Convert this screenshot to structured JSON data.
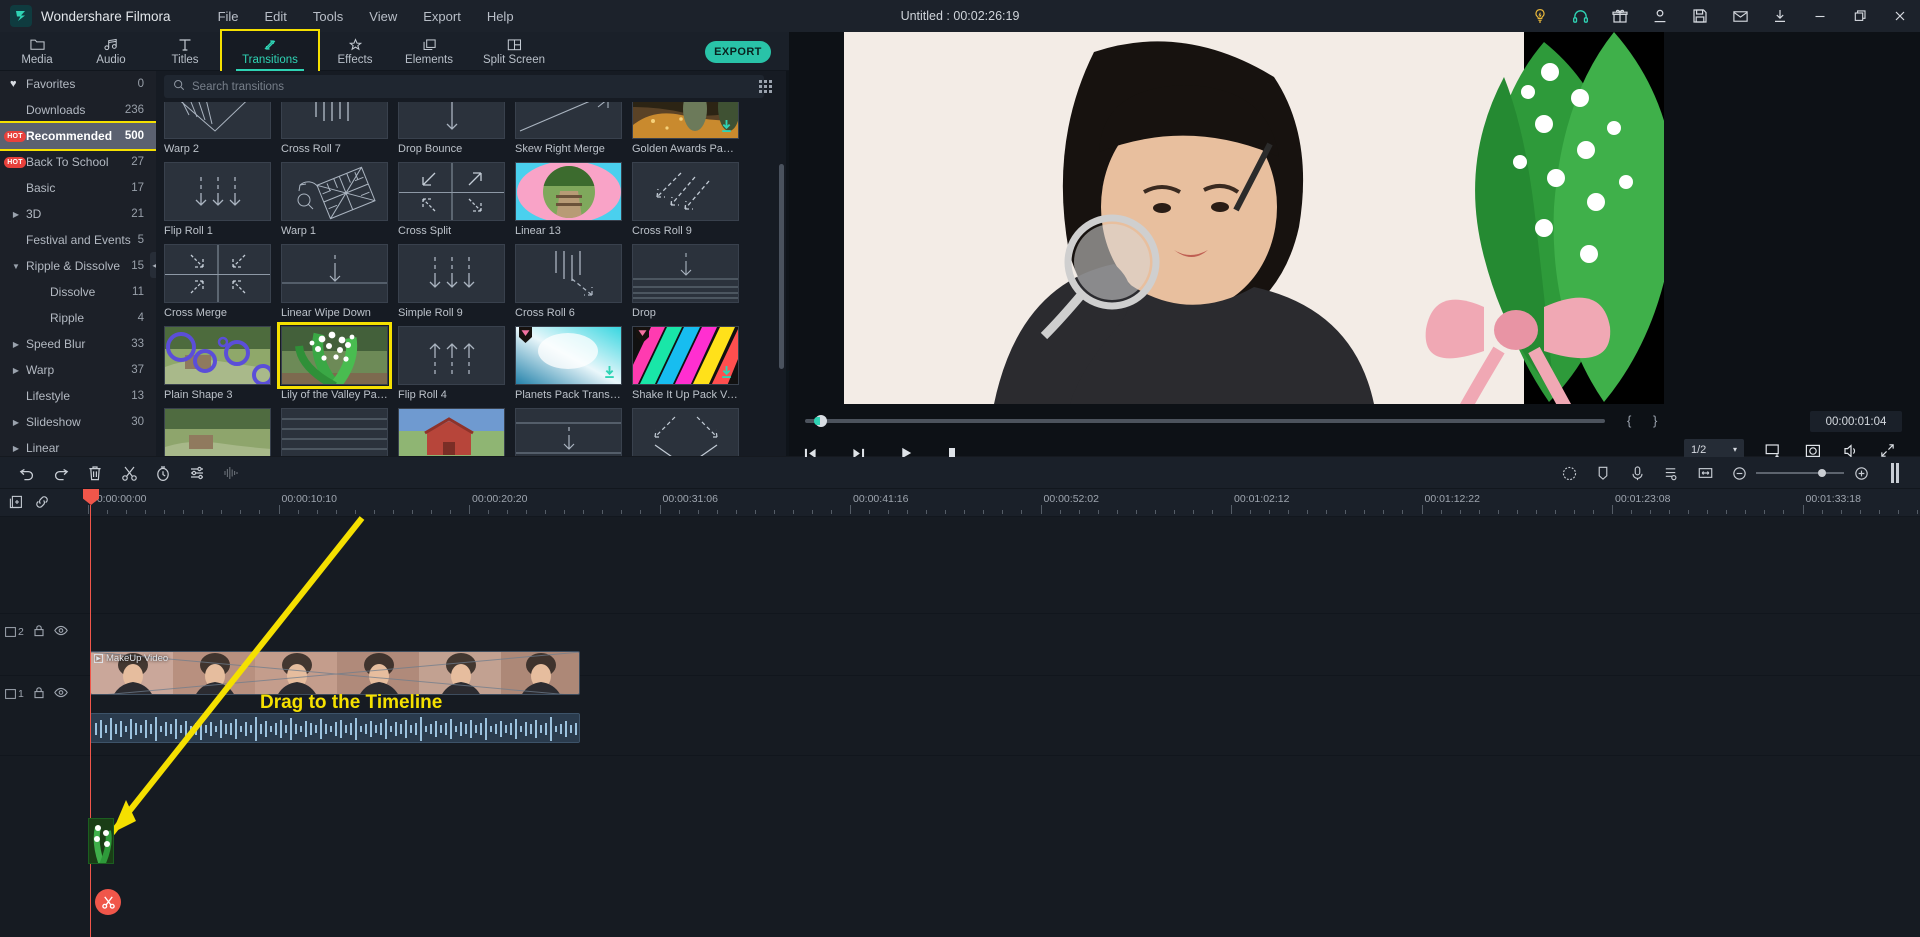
{
  "titlebar": {
    "app_name": "Wondershare Filmora",
    "document_title": "Untitled : 00:02:26:19",
    "menus": [
      "File",
      "Edit",
      "Tools",
      "View",
      "Export",
      "Help"
    ],
    "right_icons": [
      "lightbulb-icon",
      "headset-icon",
      "gift-icon",
      "account-icon",
      "save-icon",
      "mail-icon",
      "download-icon"
    ],
    "window_buttons": [
      "minimize-icon",
      "maximize-icon",
      "close-icon"
    ],
    "accent": "#2fd3b4"
  },
  "tabbar": {
    "tabs": [
      {
        "label": "Media",
        "icon": "folder-icon"
      },
      {
        "label": "Audio",
        "icon": "music-note-icon"
      },
      {
        "label": "Titles",
        "icon": "text-t-icon"
      },
      {
        "label": "Transitions",
        "icon": "transition-arrows-icon"
      },
      {
        "label": "Effects",
        "icon": "sparkle-icon"
      },
      {
        "label": "Elements",
        "icon": "layers-icon"
      },
      {
        "label": "Split Screen",
        "icon": "split-screen-icon"
      }
    ],
    "active_tab": "Transitions",
    "export_label": "EXPORT",
    "highlight_color": "#f5e000"
  },
  "sidebar": {
    "items": [
      {
        "label": "Favorites",
        "count": "0",
        "level": 0,
        "icon": "heart-icon",
        "badge": "",
        "arrow": ""
      },
      {
        "label": "Downloads",
        "count": "236",
        "level": 0,
        "icon": "",
        "badge": "",
        "arrow": ""
      },
      {
        "label": "Recommended",
        "count": "500",
        "level": 0,
        "icon": "",
        "badge": "HOT",
        "arrow": "",
        "selected": true
      },
      {
        "label": "Back To School",
        "count": "27",
        "level": 0,
        "icon": "",
        "badge": "HOT",
        "arrow": ""
      },
      {
        "label": "Basic",
        "count": "17",
        "level": 0,
        "icon": "",
        "badge": "",
        "arrow": ""
      },
      {
        "label": "3D",
        "count": "21",
        "level": 0,
        "icon": "",
        "badge": "",
        "arrow": "collapsed"
      },
      {
        "label": "Festival and Events",
        "count": "5",
        "level": 0,
        "icon": "",
        "badge": "",
        "arrow": ""
      },
      {
        "label": "Ripple & Dissolve",
        "count": "15",
        "level": 0,
        "icon": "",
        "badge": "",
        "arrow": "expanded"
      },
      {
        "label": "Dissolve",
        "count": "11",
        "level": 1,
        "icon": "",
        "badge": "",
        "arrow": ""
      },
      {
        "label": "Ripple",
        "count": "4",
        "level": 1,
        "icon": "",
        "badge": "",
        "arrow": ""
      },
      {
        "label": "Speed Blur",
        "count": "33",
        "level": 0,
        "icon": "",
        "badge": "",
        "arrow": "collapsed"
      },
      {
        "label": "Warp",
        "count": "37",
        "level": 0,
        "icon": "",
        "badge": "",
        "arrow": "collapsed"
      },
      {
        "label": "Lifestyle",
        "count": "13",
        "level": 0,
        "icon": "",
        "badge": "",
        "arrow": ""
      },
      {
        "label": "Slideshow",
        "count": "30",
        "level": 0,
        "icon": "",
        "badge": "",
        "arrow": "collapsed"
      },
      {
        "label": "Linear",
        "count": "",
        "level": 0,
        "icon": "",
        "badge": "",
        "arrow": "collapsed"
      }
    ]
  },
  "browser": {
    "search_placeholder": "Search transitions",
    "search_value": "",
    "search_icon": "magnifier-icon",
    "grid_toggle_icon": "grid-dots-icon",
    "items": [
      {
        "label": "Warp 2",
        "art": "warp2"
      },
      {
        "label": "Cross Roll 7",
        "art": "crossroll7"
      },
      {
        "label": "Drop Bounce",
        "art": "dropbounce"
      },
      {
        "label": "Skew Right Merge",
        "art": "skewright"
      },
      {
        "label": "Golden Awards Pack ...",
        "art": "golden",
        "download": true
      },
      {
        "label": "Flip Roll 1",
        "art": "fliproll1"
      },
      {
        "label": "Warp 1",
        "art": "warp1"
      },
      {
        "label": "Cross Split",
        "art": "crosssplit"
      },
      {
        "label": "Linear 13",
        "art": "linear13"
      },
      {
        "label": "Cross Roll 9",
        "art": "crossroll9"
      },
      {
        "label": "Cross Merge",
        "art": "crossmerge"
      },
      {
        "label": "Linear Wipe Down",
        "art": "linearwipedown"
      },
      {
        "label": "Simple Roll 9",
        "art": "simpleroll9"
      },
      {
        "label": "Cross Roll 6",
        "art": "crossroll6"
      },
      {
        "label": "Drop",
        "art": "drop"
      },
      {
        "label": "Plain Shape 3",
        "art": "plainshape3"
      },
      {
        "label": "Lily of the Valley Pac...",
        "art": "lily",
        "selected": true
      },
      {
        "label": "Flip Roll 4",
        "art": "fliproll4"
      },
      {
        "label": "Planets Pack Transiti...",
        "art": "planets",
        "download": true,
        "gem": true
      },
      {
        "label": "Shake It Up Pack Vol...",
        "art": "shakeitup",
        "download": true,
        "gem": true
      },
      {
        "label": "",
        "art": "row5a"
      },
      {
        "label": "",
        "art": "row5b"
      },
      {
        "label": "",
        "art": "row5c"
      },
      {
        "label": "",
        "art": "row5d"
      },
      {
        "label": "",
        "art": "row5e"
      }
    ]
  },
  "preview": {
    "current_time": "00:00:01:04",
    "speed": "1/2",
    "mark_in_icon": "brace-left-icon",
    "mark_out_icon": "brace-right-icon",
    "controls": [
      "prev-frame-button",
      "next-frame-button",
      "play-button",
      "stop-button"
    ],
    "right_controls": [
      "snapshot-to-timeline-icon",
      "camera-icon",
      "volume-icon",
      "fullscreen-icon"
    ]
  },
  "timeline_toolbar": {
    "left_icons": [
      "undo-icon",
      "redo-icon",
      "delete-icon",
      "split-scissors-icon",
      "duration-clock-icon",
      "settings-sliders-icon",
      "audio-waveform-icon"
    ],
    "right_icons": [
      "color-match-icon",
      "marker-icon",
      "voiceover-mic-icon",
      "audio-mixer-icon",
      "crop-fit-icon"
    ],
    "zoom_out_icon": "zoom-out-icon",
    "zoom_in_icon": "zoom-in-icon",
    "render_bar_icon": "render-preview-icon"
  },
  "ruler": {
    "head_icons": [
      "add-track-icon",
      "link-icon"
    ],
    "labels": [
      "00:00:00:00",
      "00:00:10:10",
      "00:00:20:20",
      "00:00:31:06",
      "00:00:41:16",
      "00:00:52:02",
      "00:01:02:12",
      "00:01:12:22",
      "00:01:23:08",
      "00:01:33:18"
    ]
  },
  "tracks": [
    {
      "name": "2",
      "index_label": "2",
      "icons": [
        "lock-icon",
        "eye-icon"
      ]
    },
    {
      "name": "1",
      "index_label": "1",
      "icons": [
        "lock-icon",
        "eye-icon"
      ]
    }
  ],
  "clip": {
    "title": "MakeUp Video",
    "play_icon": "play-small-icon"
  },
  "annotation": {
    "caption": "Drag to the Timeline",
    "arrow_color": "#f5e000",
    "caption_color": "#f5e000"
  }
}
